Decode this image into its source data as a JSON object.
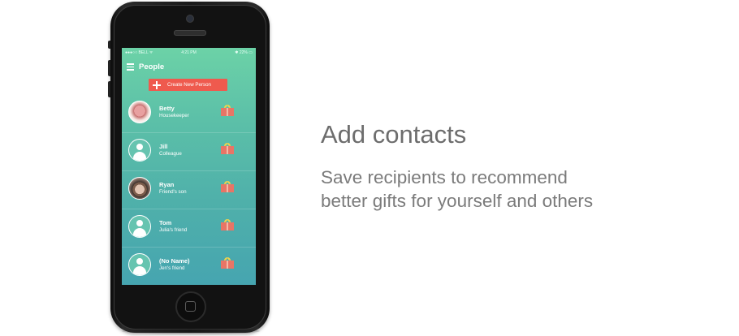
{
  "screen": {
    "status_bar": {
      "carrier": "●●●○○ BELL ᯤ",
      "time": "4:21 PM",
      "battery": "✱ 22% ▭"
    },
    "header": {
      "title": "People"
    },
    "create_button": {
      "label": "Create New Person"
    },
    "people": [
      {
        "name": "Betty",
        "relation": "Housekeeper",
        "avatar": "photo"
      },
      {
        "name": "Jill",
        "relation": "Colleague",
        "avatar": "default"
      },
      {
        "name": "Ryan",
        "relation": "Friend's son",
        "avatar": "photo"
      },
      {
        "name": "Tom",
        "relation": "Julia's friend",
        "avatar": "default"
      },
      {
        "name": "(No Name)",
        "relation": "Jen's friend",
        "avatar": "default"
      }
    ],
    "colors": {
      "accent": "#ef5a4e",
      "gradient_top": "#6cd2a7",
      "gradient_bottom": "#46a5b0"
    }
  },
  "promo": {
    "headline": "Add contacts",
    "subline_1": "Save recipients to recommend",
    "subline_2": "better gifts for yourself and others"
  }
}
